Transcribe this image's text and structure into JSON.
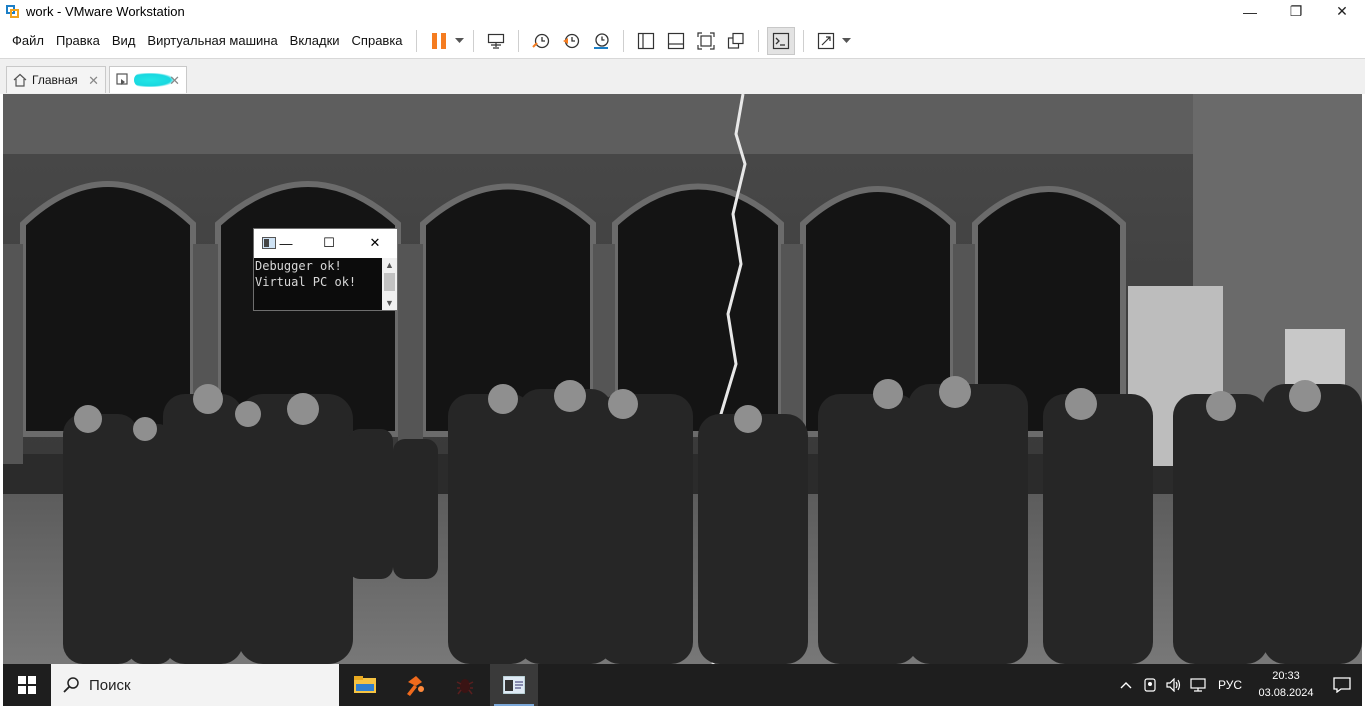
{
  "window": {
    "title": "work - VMware Workstation",
    "minimize_glyph": "—",
    "restore_glyph": "❐",
    "close_glyph": "✕"
  },
  "menu": {
    "items": [
      "Файл",
      "Правка",
      "Вид",
      "Виртуальная машина",
      "Вкладки",
      "Справка"
    ]
  },
  "toolbar": {
    "icons": [
      "pause-icon",
      "send-ctrl-alt-del-icon",
      "snapshot-take-icon",
      "snapshot-revert-icon",
      "snapshot-manager-icon",
      "show-library-icon",
      "thumbnail-bar-icon",
      "full-screen-icon",
      "unity-icon",
      "console-view-icon",
      "stretch-guest-icon"
    ],
    "accent": "#f57c20"
  },
  "tabs": {
    "home_label": "Главная",
    "close_glyph": "✕"
  },
  "console": {
    "lines": [
      "Debugger ok!",
      "Virtual PC ok!"
    ],
    "minimize_glyph": "—",
    "maximize_glyph": "☐",
    "close_glyph": "✕"
  },
  "taskbar": {
    "search_placeholder": "Поиск",
    "apps": [
      "file-explorer-icon",
      "hammer-app-icon",
      "bug-app-icon",
      "console-app-icon"
    ],
    "tray": {
      "language": "РУС",
      "time": "20:33",
      "date": "03.08.2024"
    }
  }
}
